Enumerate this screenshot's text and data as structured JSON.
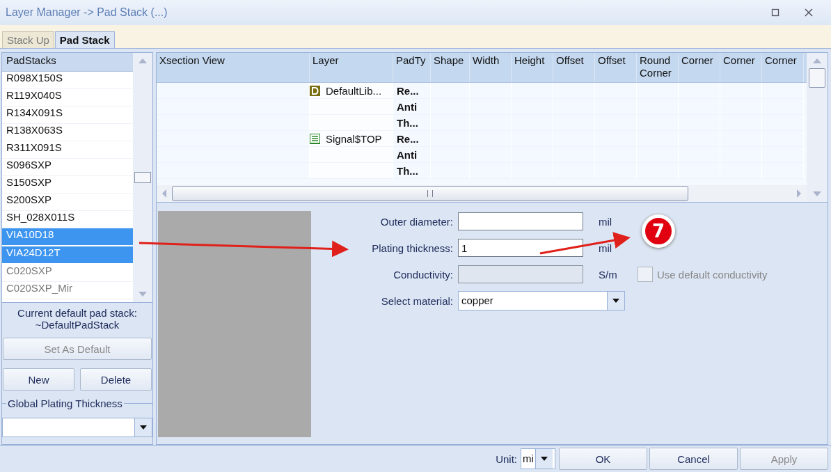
{
  "window": {
    "title": "Layer Manager -> Pad Stack (...)"
  },
  "tabs": [
    {
      "label": "Stack Up",
      "selected": false
    },
    {
      "label": "Pad Stack",
      "selected": true
    }
  ],
  "padstacks": {
    "header": "PadStacks",
    "items": [
      {
        "name": "R098X150S",
        "selected": false,
        "disabled": false
      },
      {
        "name": "R119X040S",
        "selected": false,
        "disabled": false
      },
      {
        "name": "R134X091S",
        "selected": false,
        "disabled": false
      },
      {
        "name": "R138X063S",
        "selected": false,
        "disabled": false
      },
      {
        "name": "R311X091S",
        "selected": false,
        "disabled": false
      },
      {
        "name": "S096SXP",
        "selected": false,
        "disabled": false
      },
      {
        "name": "S150SXP",
        "selected": false,
        "disabled": false
      },
      {
        "name": "S200SXP",
        "selected": false,
        "disabled": false
      },
      {
        "name": "SH_028X011S",
        "selected": false,
        "disabled": false
      },
      {
        "name": "VIA10D18",
        "selected": true,
        "disabled": false
      },
      {
        "name": "VIA24D12T",
        "selected": true,
        "disabled": false
      },
      {
        "name": "C020SXP",
        "selected": false,
        "disabled": true
      },
      {
        "name": "C020SXP_Mir",
        "selected": false,
        "disabled": true
      }
    ]
  },
  "default_info": {
    "label": "Current default pad stack:",
    "value": "~DefaultPadStack"
  },
  "buttons_left": {
    "set_default": {
      "label": "Set As Default",
      "disabled": true
    },
    "new": "New",
    "delete": "Delete"
  },
  "global_plating": {
    "legend": "Global Plating Thickness"
  },
  "grid": {
    "columns": [
      "Xsection View",
      "Layer",
      "PadTy",
      "Shape",
      "Width",
      "Height",
      "Offset",
      "Offset",
      "Round Corner",
      "Corner",
      "Corner",
      "Corner"
    ],
    "rows": [
      {
        "layer": "DefaultLib...",
        "kind": "default",
        "pad_types": [
          "Re...",
          "Anti",
          "Th..."
        ]
      },
      {
        "layer": "Signal$TOP",
        "kind": "signal",
        "pad_types": [
          "Re...",
          "Anti",
          "Th..."
        ]
      }
    ]
  },
  "form": {
    "fields": [
      {
        "label": "Outer diameter:",
        "unit": "mil",
        "disabled": false
      },
      {
        "label": "Plating thickness:",
        "value": "1",
        "unit": "mil",
        "disabled": false
      },
      {
        "label": "Conductivity:",
        "unit": "S/m",
        "disabled": true
      }
    ],
    "default_conductivity": {
      "label": "Use default conductivity",
      "checked": false,
      "disabled": true
    },
    "material": {
      "label": "Select material:",
      "value": "copper"
    }
  },
  "annotation": {
    "badge": "7"
  },
  "footer": {
    "unit_label": "Unit:",
    "unit_value": "mi",
    "buttons": [
      {
        "label": "OK",
        "disabled": false
      },
      {
        "label": "Cancel",
        "disabled": false
      },
      {
        "label": "Apply",
        "disabled": true
      }
    ]
  }
}
